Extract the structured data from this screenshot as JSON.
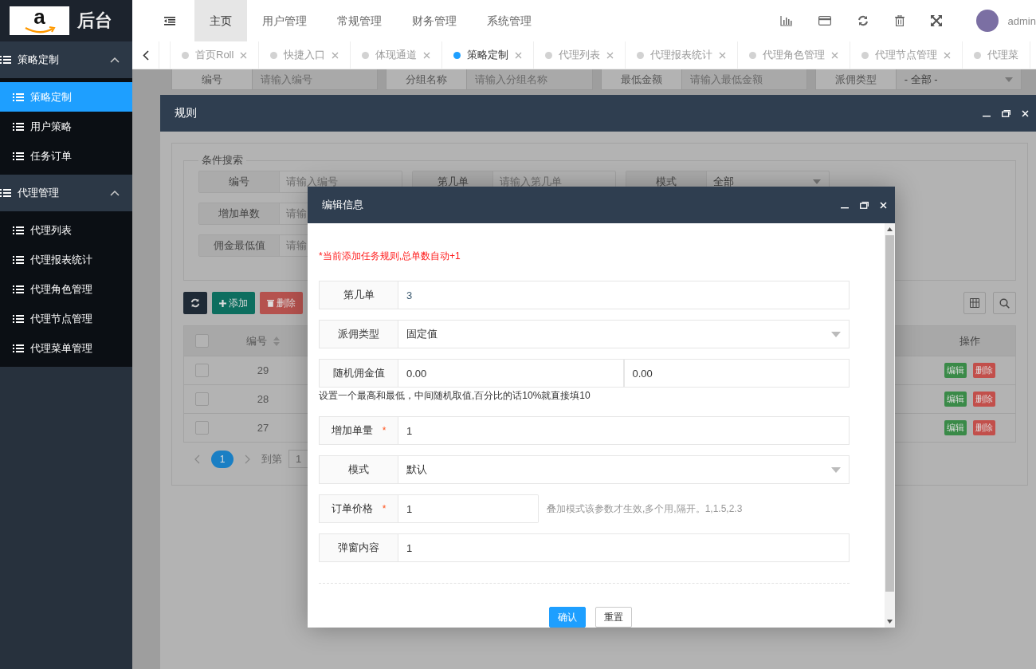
{
  "brand": {
    "logo_mark": "a",
    "title": "后台"
  },
  "sidebar": {
    "groups": [
      {
        "label": "策略定制",
        "expanded": true,
        "items": [
          {
            "label": "策略定制",
            "selected": true
          },
          {
            "label": "用户策略",
            "selected": false
          },
          {
            "label": "任务订单",
            "selected": false
          }
        ]
      },
      {
        "label": "代理管理",
        "expanded": true,
        "items": [
          {
            "label": "代理列表",
            "selected": false
          },
          {
            "label": "代理报表统计",
            "selected": false
          },
          {
            "label": "代理角色管理",
            "selected": false
          },
          {
            "label": "代理节点管理",
            "selected": false
          },
          {
            "label": "代理菜单管理",
            "selected": false
          }
        ]
      }
    ]
  },
  "top_nav": {
    "items": [
      {
        "label": "主页",
        "selected": true
      },
      {
        "label": "用户管理",
        "selected": false
      },
      {
        "label": "常规管理",
        "selected": false
      },
      {
        "label": "财务管理",
        "selected": false
      },
      {
        "label": "系统管理",
        "selected": false
      }
    ],
    "user": "admin"
  },
  "tabs": [
    {
      "label": "首页Roll",
      "selected": false,
      "closable": true
    },
    {
      "label": "快捷入口",
      "selected": false,
      "closable": true
    },
    {
      "label": "体现通道",
      "selected": false,
      "closable": true
    },
    {
      "label": "策略定制",
      "selected": true,
      "closable": true
    },
    {
      "label": "代理列表",
      "selected": false,
      "closable": true
    },
    {
      "label": "代理报表统计",
      "selected": false,
      "closable": true
    },
    {
      "label": "代理角色管理",
      "selected": false,
      "closable": true
    },
    {
      "label": "代理节点管理",
      "selected": false,
      "closable": true
    },
    {
      "label": "代理菜",
      "selected": false,
      "closable": false
    }
  ],
  "page_search": {
    "fields": [
      {
        "kind": "input",
        "label": "编号",
        "placeholder": "请输入编号"
      },
      {
        "kind": "input",
        "label": "分组名称",
        "placeholder": "请输入分组名称"
      },
      {
        "kind": "input",
        "label": "最低金额",
        "placeholder": "请输入最低金额"
      },
      {
        "kind": "select",
        "label": "派佣类型",
        "value": "- 全部 -"
      }
    ]
  },
  "rule_dialog": {
    "title": "规则",
    "search": {
      "legend": "条件搜索",
      "rows": [
        [
          {
            "kind": "input",
            "label": "编号",
            "placeholder": "请输入编号"
          },
          {
            "kind": "input",
            "label": "第几单",
            "placeholder": "请输入第几单"
          },
          {
            "kind": "select",
            "label": "模式",
            "value": "全部"
          }
        ],
        [
          {
            "kind": "input",
            "label": "增加单数",
            "placeholder": "请输"
          }
        ],
        [
          {
            "kind": "input",
            "label": "佣金最低值",
            "placeholder": "请输"
          }
        ]
      ]
    },
    "toolbar": {
      "add": "添加",
      "delete": "删除"
    },
    "table": {
      "columns": [
        "编号",
        "操作"
      ],
      "all_checked": false,
      "rows": [
        {
          "id": "29",
          "checked": false,
          "actions": [
            "编辑",
            "删除"
          ]
        },
        {
          "id": "28",
          "checked": false,
          "actions": [
            "编辑",
            "删除"
          ]
        },
        {
          "id": "27",
          "checked": false,
          "actions": [
            "编辑",
            "删除"
          ]
        }
      ]
    },
    "pagination": {
      "pages": [
        {
          "label": "1",
          "selected": true
        }
      ],
      "goto_label": "到第",
      "goto_value": "1"
    }
  },
  "edit_dialog": {
    "title": "编辑信息",
    "note": "*当前添加任务规则,总单数自动+1",
    "fields": [
      {
        "kind": "input",
        "label": "第几单",
        "value": "3"
      },
      {
        "kind": "select",
        "label": "派佣类型",
        "value": "固定值"
      },
      {
        "kind": "range",
        "label": "随机佣金值",
        "values": [
          "0.00",
          "0.00"
        ],
        "help": "设置一个最高和最低，中间随机取值,百分比的话10%就直接填10"
      },
      {
        "kind": "input",
        "label": "增加单量",
        "value": "1",
        "required_mark": "*"
      },
      {
        "kind": "select",
        "label": "模式",
        "value": "默认"
      },
      {
        "kind": "short",
        "label": "订单价格",
        "value": "1",
        "required_mark": "*",
        "hint": "叠加模式该参数才生效,多个用,隔开。1,1.5,2.3"
      },
      {
        "kind": "input",
        "label": "弹窗内容",
        "value": "1"
      }
    ],
    "buttons": [
      {
        "label": "确认",
        "primary": true
      },
      {
        "label": "重置",
        "primary": false
      }
    ]
  }
}
